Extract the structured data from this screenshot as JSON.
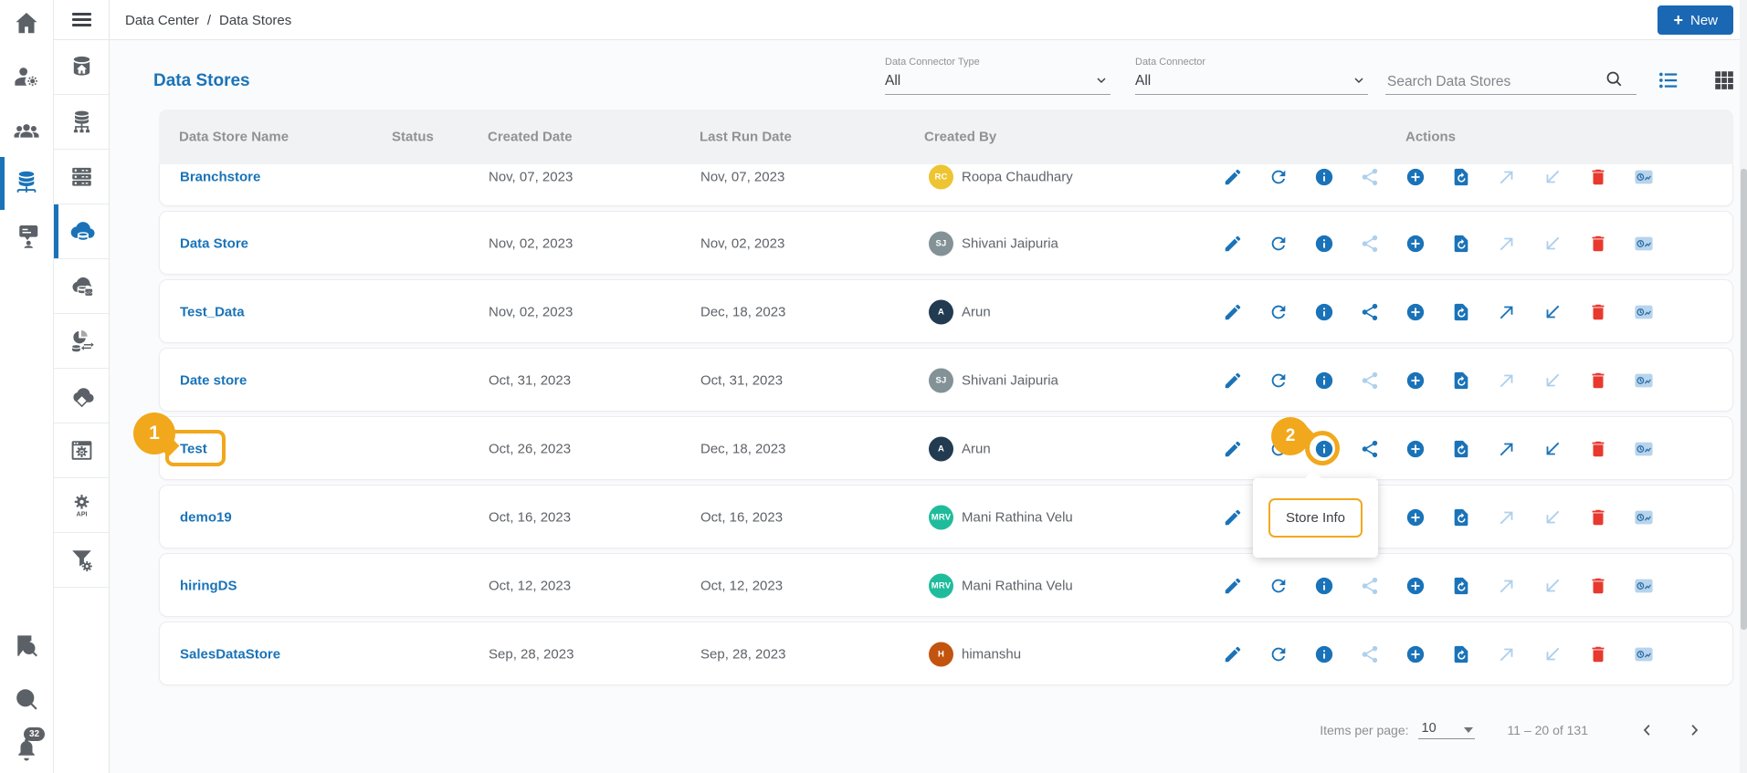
{
  "topbar": {
    "breadcrumb": [
      "Data Center",
      "Data Stores"
    ],
    "separator": "/",
    "new_button": {
      "plus": "+",
      "label": "New"
    }
  },
  "page": {
    "title": "Data Stores"
  },
  "filters": {
    "connector_type": {
      "label": "Data Connector Type",
      "value": "All"
    },
    "connector": {
      "label": "Data Connector",
      "value": "All"
    },
    "search_placeholder": "Search Data Stores"
  },
  "table": {
    "columns": [
      "Data Store Name",
      "Status",
      "Created Date",
      "Last Run Date",
      "Created By",
      "Actions"
    ],
    "action_names": [
      "edit",
      "refresh",
      "info",
      "share",
      "add",
      "restore",
      "export",
      "import",
      "delete",
      "usage-history"
    ],
    "rows": [
      {
        "name": "Branchstore",
        "status": "",
        "created": "Nov, 07, 2023",
        "last_run": "Nov, 07, 2023",
        "created_by": "Roopa Chaudhary",
        "initials": "RC",
        "avatar_color": "#eec432",
        "share": false,
        "export": false,
        "import": false,
        "clipped": true
      },
      {
        "name": "Data Store",
        "status": "",
        "created": "Nov, 02, 2023",
        "last_run": "Nov, 02, 2023",
        "created_by": "Shivani Jaipuria",
        "initials": "SJ",
        "avatar_color": "#839296",
        "share": false,
        "export": false,
        "import": false
      },
      {
        "name": "Test_Data",
        "status": "",
        "created": "Nov, 02, 2023",
        "last_run": "Dec, 18, 2023",
        "created_by": "Arun",
        "initials": "A",
        "avatar_color": "#223b50",
        "share": true,
        "export": true,
        "import": true
      },
      {
        "name": "Date store",
        "status": "",
        "created": "Oct, 31, 2023",
        "last_run": "Oct, 31, 2023",
        "created_by": "Shivani Jaipuria",
        "initials": "SJ",
        "avatar_color": "#839296",
        "share": false,
        "export": false,
        "import": false
      },
      {
        "name": "Test",
        "status": "",
        "created": "Oct, 26, 2023",
        "last_run": "Dec, 18, 2023",
        "created_by": "Arun",
        "initials": "A",
        "avatar_color": "#223b50",
        "share": true,
        "export": true,
        "import": true,
        "annotated": true
      },
      {
        "name": "demo19",
        "status": "",
        "created": "Oct, 16, 2023",
        "last_run": "Oct, 16, 2023",
        "created_by": "Mani Rathina Velu",
        "initials": "MRV",
        "avatar_color": "#1fbc9c",
        "share": false,
        "export": false,
        "import": false
      },
      {
        "name": "hiringDS",
        "status": "",
        "created": "Oct, 12, 2023",
        "last_run": "Oct, 12, 2023",
        "created_by": "Mani Rathina Velu",
        "initials": "MRV",
        "avatar_color": "#1fbc9c",
        "share": false,
        "export": false,
        "import": false
      },
      {
        "name": "SalesDataStore",
        "status": "",
        "created": "Sep, 28, 2023",
        "last_run": "Sep, 28, 2023",
        "created_by": "himanshu",
        "initials": "H",
        "avatar_color": "#c2540f",
        "share": false,
        "export": false,
        "import": false
      }
    ]
  },
  "annotations": {
    "step1": "1",
    "step2": "2",
    "tooltip": "Store Info"
  },
  "pagination": {
    "items_per_page_label": "Items per page:",
    "items_per_page": "10",
    "range": "11 – 20 of 131"
  },
  "sidebar": {
    "notification_count": "32",
    "api_label": "API"
  },
  "colors": {
    "accent": "#1a73b8",
    "button": "#1a68b4",
    "annotation": "#f1a81c",
    "danger": "#e8392f",
    "disabled_action": "#aed0ec"
  }
}
